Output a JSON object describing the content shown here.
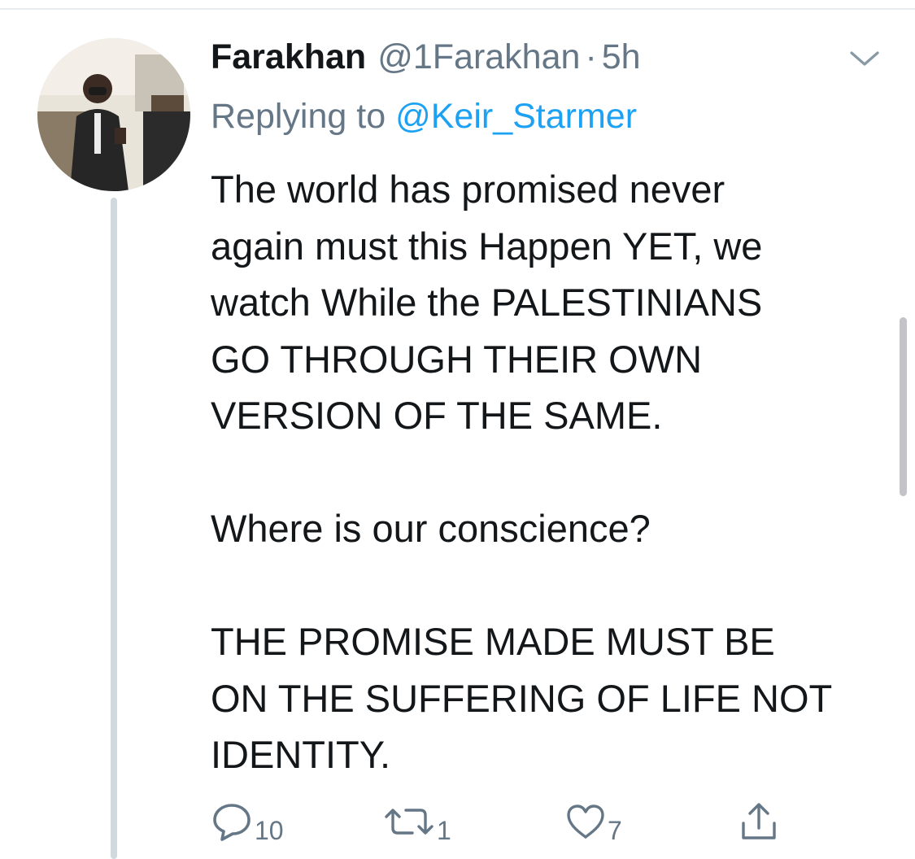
{
  "tweet": {
    "author": {
      "display_name": "Farakhan",
      "handle": "@1Farakhan",
      "separator": "·",
      "timestamp": "5h"
    },
    "reply": {
      "label": "Replying to",
      "target": "@Keir_Starmer"
    },
    "text": {
      "paragraph_1": "The world has promised never\nagain must this Happen YET, we\nwatch While the PALESTINIANS\nGO THROUGH THEIR OWN\nVERSION OF THE SAME.",
      "paragraph_2": "Where is our conscience?",
      "paragraph_3": "THE PROMISE MADE MUST BE\nON THE SUFFERING OF LIFE NOT\nIDENTITY."
    },
    "actions": {
      "reply_count": "10",
      "retweet_count": "1",
      "like_count": "7",
      "share_count": ""
    },
    "icons": {
      "menu": "chevron-down-icon",
      "reply": "speech-bubble-icon",
      "retweet": "retweet-icon",
      "like": "heart-icon",
      "share": "share-icon"
    },
    "colors": {
      "text": "#14171a",
      "secondary": "#657786",
      "link": "#1da1f2",
      "thread_line": "#cfd9de"
    }
  }
}
